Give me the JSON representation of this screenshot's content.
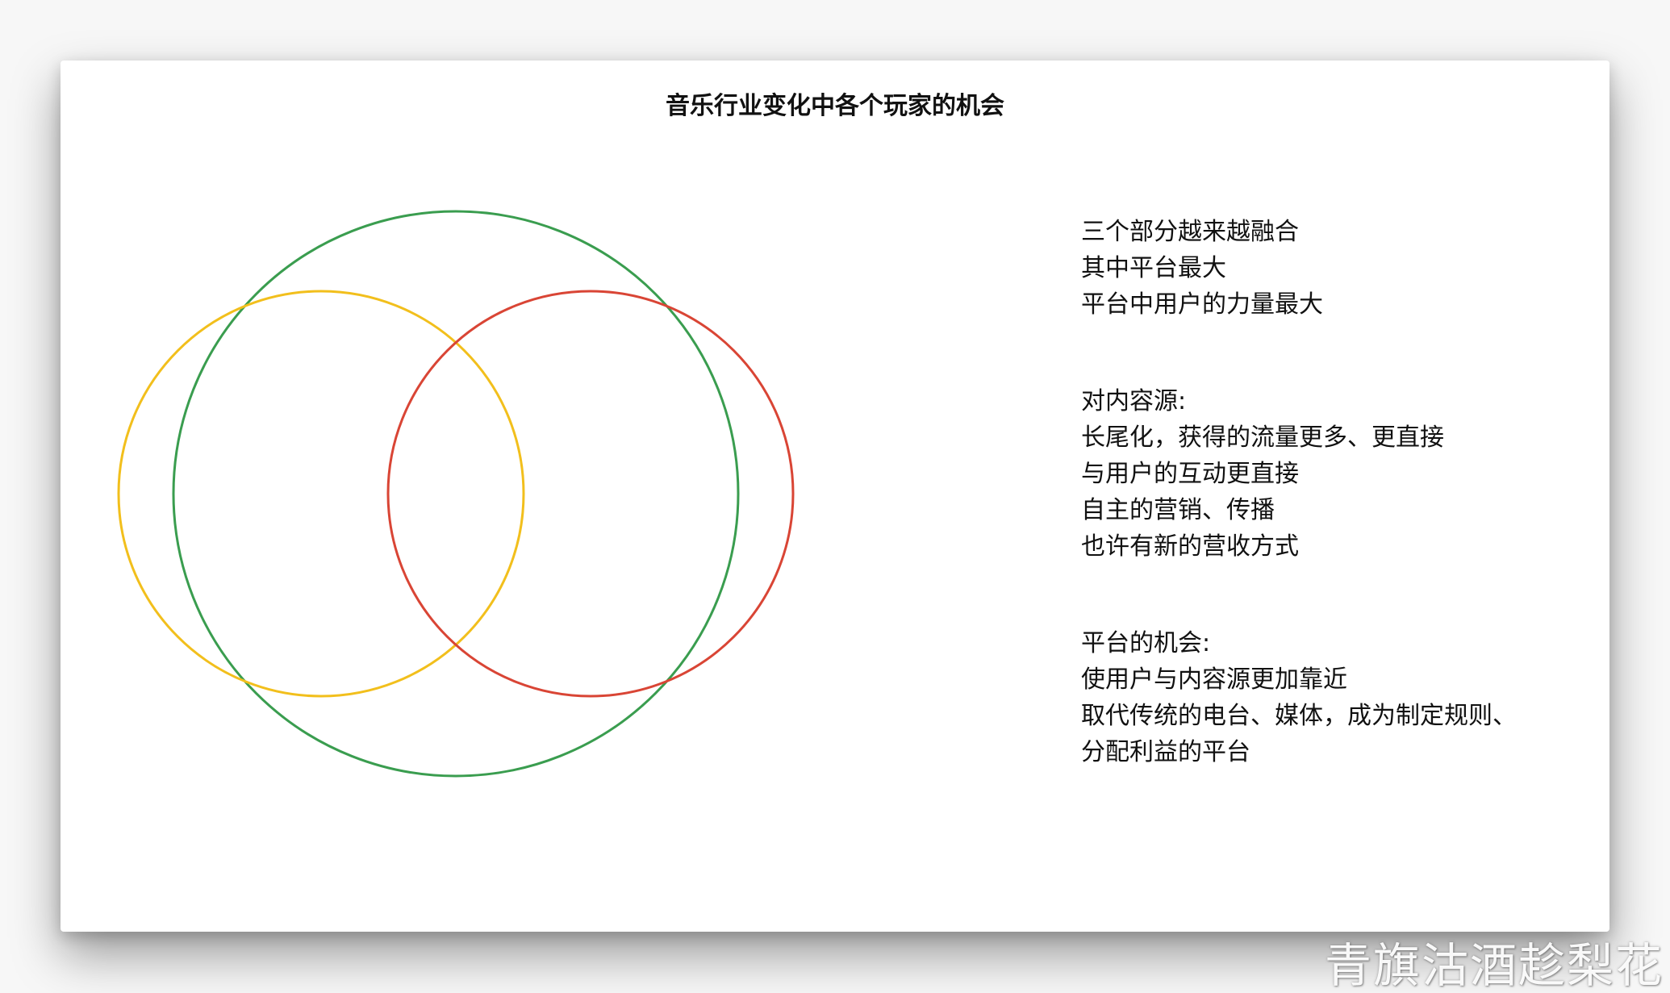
{
  "title": "音乐行业变化中各个玩家的机会",
  "circle_colors": {
    "platform": "#3a9d4f",
    "left": "#f2bf1c",
    "right": "#d94535"
  },
  "notes": {
    "group1": [
      "三个部分越来越融合",
      "其中平台最大",
      "平台中用户的力量最大"
    ],
    "group2": [
      "对内容源:",
      "长尾化，获得的流量更多、更直接",
      "与用户的互动更直接",
      "自主的营销、传播",
      "也许有新的营收方式"
    ],
    "group3": [
      "平台的机会:",
      "使用户与内容源更加靠近",
      "取代传统的电台、媒体，成为制定规则、",
      "分配利益的平台"
    ]
  },
  "watermark": "青旗沽酒趁梨花"
}
